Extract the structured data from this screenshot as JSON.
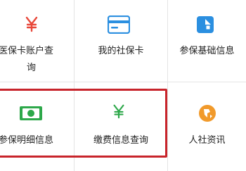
{
  "items": [
    {
      "label_line1": "医保卡账户查",
      "label_line2": "询",
      "icon": "yuan-icon",
      "icon_color": "#e8483a"
    },
    {
      "label": "我的社保卡",
      "icon": "card-icon",
      "icon_color": "#2b8fe0"
    },
    {
      "label": "参保基础信息",
      "icon": "cube-icon",
      "icon_color": "#2b8fe0"
    },
    {
      "label": "参保明细信息",
      "icon": "cash-icon",
      "icon_color": "#2da84a"
    },
    {
      "label": "缴费信息查询",
      "icon": "yuan-icon",
      "icon_color": "#2da84a"
    },
    {
      "label": "人社资讯",
      "icon": "news-icon",
      "icon_color": "#f19a2b"
    }
  ],
  "highlight_color": "#c8242b"
}
